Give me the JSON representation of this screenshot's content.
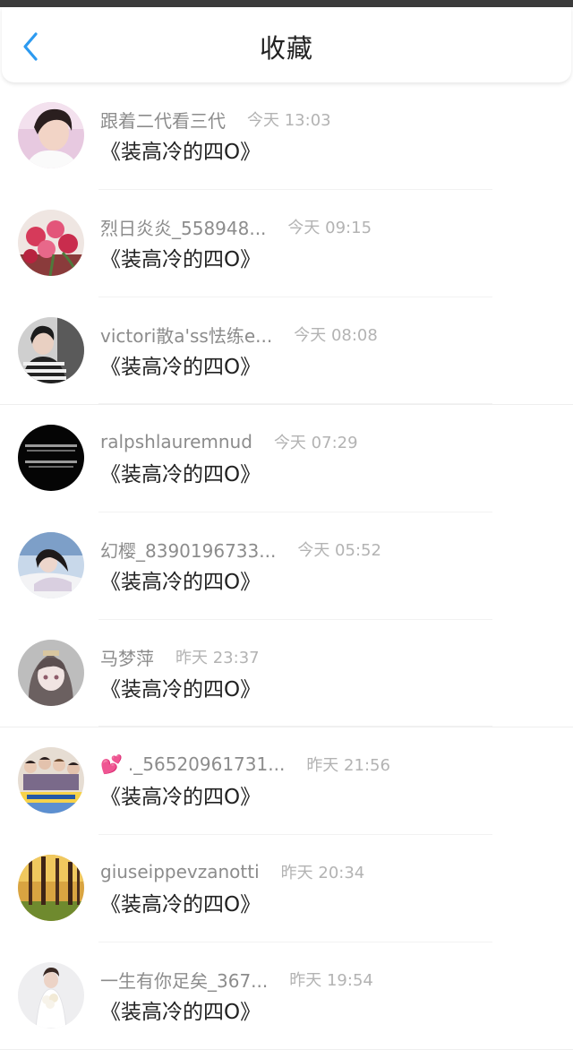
{
  "header": {
    "title": "收藏",
    "back_icon": "chevron-left-icon",
    "accent_color": "#2c9af0"
  },
  "favorites": [
    {
      "username": "跟着二代看三代",
      "time": "今天 13:03",
      "book_title": "《装高冷的四O》",
      "avatar_icon": "avatar-boy-portrait"
    },
    {
      "username": "烈日炎炎_558948...",
      "time": "今天 09:15",
      "book_title": "《装高冷的四O》",
      "avatar_icon": "avatar-roses"
    },
    {
      "username": "victori散a'ss怯练e...",
      "time": "今天 08:08",
      "book_title": "《装高冷的四O》",
      "avatar_icon": "avatar-striped-shirt"
    },
    {
      "username": "ralpshlauremnud",
      "time": "今天 07:29",
      "book_title": "《装高冷的四O》",
      "avatar_icon": "avatar-dark-text"
    },
    {
      "username": "幻樱_8390196733...",
      "time": "今天 05:52",
      "book_title": "《装高冷的四O》",
      "avatar_icon": "avatar-girl-snow"
    },
    {
      "username": "马梦萍",
      "time": "昨天 23:37",
      "book_title": "《装高冷的四O》",
      "avatar_icon": "avatar-anime-girl"
    },
    {
      "username": "._56520961731...",
      "time": "昨天 21:56",
      "book_title": "《装高冷的四O》",
      "avatar_icon": "avatar-group-photo",
      "has_heart": true,
      "heart": "💕"
    },
    {
      "username": "giuseippevzanotti",
      "time": "昨天 20:34",
      "book_title": "《装高冷的四O》",
      "avatar_icon": "avatar-autumn-forest"
    },
    {
      "username": "一生有你足矣_367...",
      "time": "昨天 19:54",
      "book_title": "《装高冷的四O》",
      "avatar_icon": "avatar-bride"
    }
  ]
}
